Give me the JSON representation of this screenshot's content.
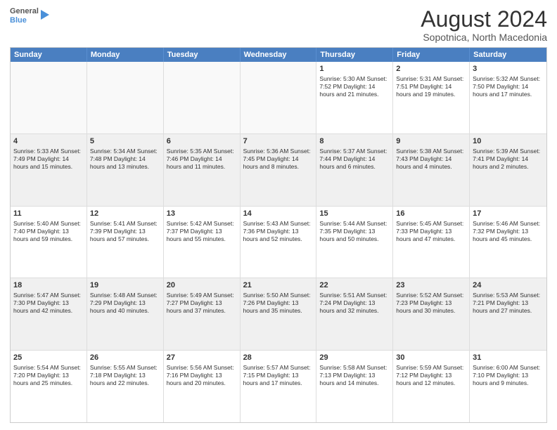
{
  "logo": {
    "line1": "General",
    "line2": "Blue"
  },
  "title": "August 2024",
  "subtitle": "Sopotnica, North Macedonia",
  "days": [
    "Sunday",
    "Monday",
    "Tuesday",
    "Wednesday",
    "Thursday",
    "Friday",
    "Saturday"
  ],
  "rows": [
    [
      {
        "day": "",
        "text": "",
        "empty": true
      },
      {
        "day": "",
        "text": "",
        "empty": true
      },
      {
        "day": "",
        "text": "",
        "empty": true
      },
      {
        "day": "",
        "text": "",
        "empty": true
      },
      {
        "day": "1",
        "text": "Sunrise: 5:30 AM\nSunset: 7:52 PM\nDaylight: 14 hours\nand 21 minutes."
      },
      {
        "day": "2",
        "text": "Sunrise: 5:31 AM\nSunset: 7:51 PM\nDaylight: 14 hours\nand 19 minutes."
      },
      {
        "day": "3",
        "text": "Sunrise: 5:32 AM\nSunset: 7:50 PM\nDaylight: 14 hours\nand 17 minutes."
      }
    ],
    [
      {
        "day": "4",
        "text": "Sunrise: 5:33 AM\nSunset: 7:49 PM\nDaylight: 14 hours\nand 15 minutes.",
        "shaded": true
      },
      {
        "day": "5",
        "text": "Sunrise: 5:34 AM\nSunset: 7:48 PM\nDaylight: 14 hours\nand 13 minutes.",
        "shaded": true
      },
      {
        "day": "6",
        "text": "Sunrise: 5:35 AM\nSunset: 7:46 PM\nDaylight: 14 hours\nand 11 minutes.",
        "shaded": true
      },
      {
        "day": "7",
        "text": "Sunrise: 5:36 AM\nSunset: 7:45 PM\nDaylight: 14 hours\nand 8 minutes.",
        "shaded": true
      },
      {
        "day": "8",
        "text": "Sunrise: 5:37 AM\nSunset: 7:44 PM\nDaylight: 14 hours\nand 6 minutes.",
        "shaded": true
      },
      {
        "day": "9",
        "text": "Sunrise: 5:38 AM\nSunset: 7:43 PM\nDaylight: 14 hours\nand 4 minutes.",
        "shaded": true
      },
      {
        "day": "10",
        "text": "Sunrise: 5:39 AM\nSunset: 7:41 PM\nDaylight: 14 hours\nand 2 minutes.",
        "shaded": true
      }
    ],
    [
      {
        "day": "11",
        "text": "Sunrise: 5:40 AM\nSunset: 7:40 PM\nDaylight: 13 hours\nand 59 minutes."
      },
      {
        "day": "12",
        "text": "Sunrise: 5:41 AM\nSunset: 7:39 PM\nDaylight: 13 hours\nand 57 minutes."
      },
      {
        "day": "13",
        "text": "Sunrise: 5:42 AM\nSunset: 7:37 PM\nDaylight: 13 hours\nand 55 minutes."
      },
      {
        "day": "14",
        "text": "Sunrise: 5:43 AM\nSunset: 7:36 PM\nDaylight: 13 hours\nand 52 minutes."
      },
      {
        "day": "15",
        "text": "Sunrise: 5:44 AM\nSunset: 7:35 PM\nDaylight: 13 hours\nand 50 minutes."
      },
      {
        "day": "16",
        "text": "Sunrise: 5:45 AM\nSunset: 7:33 PM\nDaylight: 13 hours\nand 47 minutes."
      },
      {
        "day": "17",
        "text": "Sunrise: 5:46 AM\nSunset: 7:32 PM\nDaylight: 13 hours\nand 45 minutes."
      }
    ],
    [
      {
        "day": "18",
        "text": "Sunrise: 5:47 AM\nSunset: 7:30 PM\nDaylight: 13 hours\nand 42 minutes.",
        "shaded": true
      },
      {
        "day": "19",
        "text": "Sunrise: 5:48 AM\nSunset: 7:29 PM\nDaylight: 13 hours\nand 40 minutes.",
        "shaded": true
      },
      {
        "day": "20",
        "text": "Sunrise: 5:49 AM\nSunset: 7:27 PM\nDaylight: 13 hours\nand 37 minutes.",
        "shaded": true
      },
      {
        "day": "21",
        "text": "Sunrise: 5:50 AM\nSunset: 7:26 PM\nDaylight: 13 hours\nand 35 minutes.",
        "shaded": true
      },
      {
        "day": "22",
        "text": "Sunrise: 5:51 AM\nSunset: 7:24 PM\nDaylight: 13 hours\nand 32 minutes.",
        "shaded": true
      },
      {
        "day": "23",
        "text": "Sunrise: 5:52 AM\nSunset: 7:23 PM\nDaylight: 13 hours\nand 30 minutes.",
        "shaded": true
      },
      {
        "day": "24",
        "text": "Sunrise: 5:53 AM\nSunset: 7:21 PM\nDaylight: 13 hours\nand 27 minutes.",
        "shaded": true
      }
    ],
    [
      {
        "day": "25",
        "text": "Sunrise: 5:54 AM\nSunset: 7:20 PM\nDaylight: 13 hours\nand 25 minutes."
      },
      {
        "day": "26",
        "text": "Sunrise: 5:55 AM\nSunset: 7:18 PM\nDaylight: 13 hours\nand 22 minutes."
      },
      {
        "day": "27",
        "text": "Sunrise: 5:56 AM\nSunset: 7:16 PM\nDaylight: 13 hours\nand 20 minutes."
      },
      {
        "day": "28",
        "text": "Sunrise: 5:57 AM\nSunset: 7:15 PM\nDaylight: 13 hours\nand 17 minutes."
      },
      {
        "day": "29",
        "text": "Sunrise: 5:58 AM\nSunset: 7:13 PM\nDaylight: 13 hours\nand 14 minutes."
      },
      {
        "day": "30",
        "text": "Sunrise: 5:59 AM\nSunset: 7:12 PM\nDaylight: 13 hours\nand 12 minutes."
      },
      {
        "day": "31",
        "text": "Sunrise: 6:00 AM\nSunset: 7:10 PM\nDaylight: 13 hours\nand 9 minutes."
      }
    ]
  ]
}
